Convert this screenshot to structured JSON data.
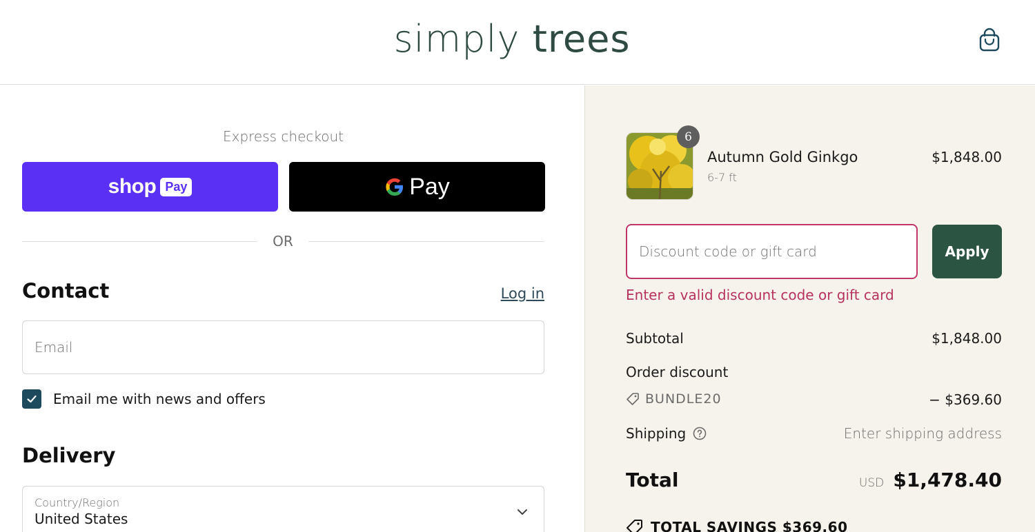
{
  "header": {
    "logo_part1": "simply",
    "logo_part2": "trees",
    "cart_icon": "shopping-bag-icon"
  },
  "express": {
    "label": "Express checkout",
    "shop_pay": {
      "text": "shop",
      "badge": "Pay",
      "color": "#5a31f4"
    },
    "google_pay": {
      "text": "Pay",
      "icon": "google-g-icon"
    },
    "or_text": "OR"
  },
  "contact": {
    "title": "Contact",
    "login_link": "Log in",
    "email_placeholder": "Email",
    "newsletter_label": "Email me with news and offers",
    "newsletter_checked": true
  },
  "delivery": {
    "title": "Delivery",
    "country_label": "Country/Region",
    "country_value": "United States"
  },
  "summary": {
    "product": {
      "name": "Autumn Gold Ginkgo",
      "variant": "6-7 ft",
      "price": "$1,848.00",
      "quantity": "6"
    },
    "discount": {
      "placeholder": "Discount code or gift card",
      "apply_label": "Apply",
      "error": "Enter a valid discount code or gift card",
      "error_color": "#c1356b"
    },
    "subtotal_label": "Subtotal",
    "subtotal_value": "$1,848.00",
    "order_discount_label": "Order discount",
    "discount_code": "BUNDLE20",
    "discount_amount": "− $369.60",
    "shipping_label": "Shipping",
    "shipping_value": "Enter shipping address",
    "total_label": "Total",
    "total_currency": "USD",
    "total_amount": "$1,478.40",
    "savings_text": "TOTAL SAVINGS  $369.60"
  },
  "colors": {
    "brand": "#2e4a42",
    "apply_button": "#2b5442",
    "summary_background": "#f6f2ec"
  }
}
